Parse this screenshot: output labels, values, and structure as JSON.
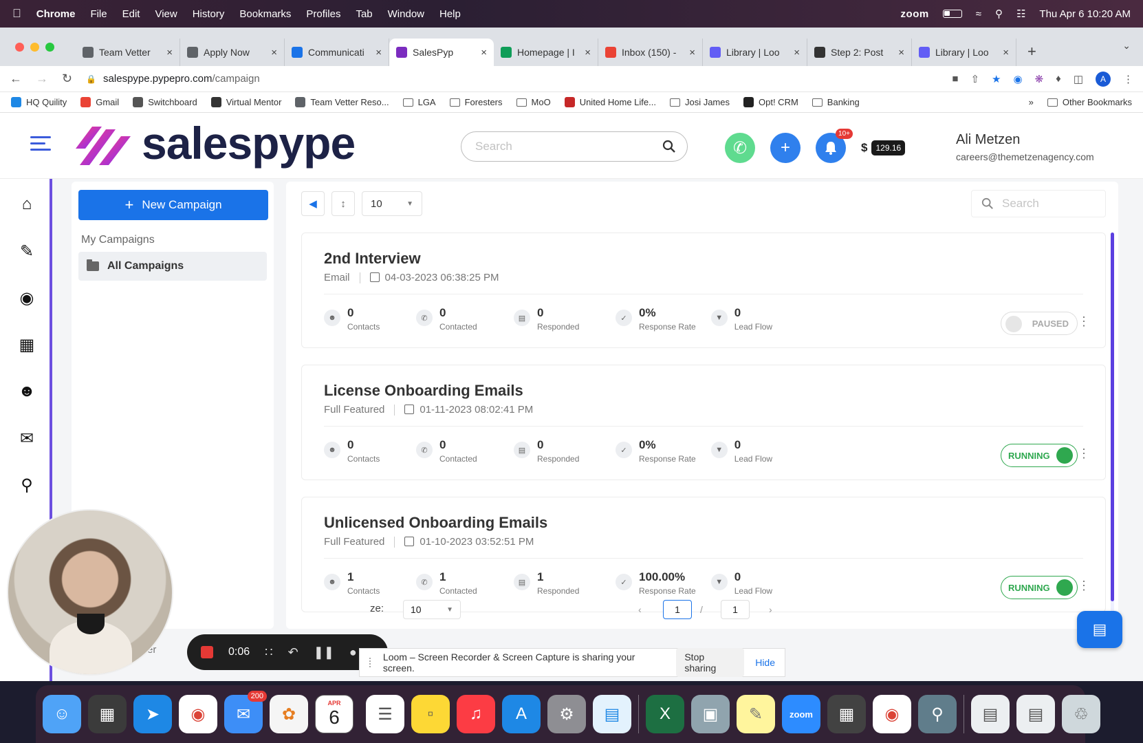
{
  "menubar": {
    "app": "Chrome",
    "items": [
      "File",
      "Edit",
      "View",
      "History",
      "Bookmarks",
      "Profiles",
      "Tab",
      "Window",
      "Help"
    ],
    "zoom_label": "zoom",
    "datetime": "Thu Apr 6  10:20 AM"
  },
  "tabs": [
    {
      "label": "Team Vetter",
      "color": "#5f6368"
    },
    {
      "label": "Apply Now",
      "color": "#5f6368"
    },
    {
      "label": "Communicati",
      "color": "#1a73e8"
    },
    {
      "label": "SalesPyp",
      "color": "#7b2cbf",
      "active": true
    },
    {
      "label": "Homepage | I",
      "color": "#0f9d58"
    },
    {
      "label": "Inbox (150) -",
      "color": "#ea4335"
    },
    {
      "label": "Library | Loo",
      "color": "#625df5"
    },
    {
      "label": "Step 2: Post",
      "color": "#333333"
    },
    {
      "label": "Library | Loo",
      "color": "#625df5"
    }
  ],
  "address": {
    "host": "salespype.pypepro.com",
    "path": "/campaign"
  },
  "bookmarks": [
    {
      "label": "HQ Quility",
      "color": "#1e88e5"
    },
    {
      "label": "Gmail",
      "color": "#ea4335"
    },
    {
      "label": "Switchboard",
      "color": "#555555"
    },
    {
      "label": "Virtual Mentor",
      "color": "#333333"
    },
    {
      "label": "Team Vetter Reso...",
      "color": "#5f6368"
    },
    {
      "label": "LGA",
      "folder": true
    },
    {
      "label": "Foresters",
      "folder": true
    },
    {
      "label": "MoO",
      "folder": true
    },
    {
      "label": "United Home Life...",
      "color": "#c62828"
    },
    {
      "label": "Josi James",
      "folder": true
    },
    {
      "label": "Opt! CRM",
      "color": "#222222"
    },
    {
      "label": "Banking",
      "folder": true
    }
  ],
  "bookmarks_overflow": "»",
  "bookmarks_other": "Other Bookmarks",
  "header": {
    "logo": "salespype",
    "search_placeholder": "Search",
    "notif_badge": "10+",
    "currency": "$",
    "balance": "129.16",
    "user_name": "Ali Metzen",
    "user_email": "careers@themetzenagency.com"
  },
  "sidebar": {
    "new_campaign": "New Campaign",
    "section_title": "My Campaigns",
    "folder": "All Campaigns"
  },
  "toolbar": {
    "per_page": "10",
    "search_placeholder": "Search"
  },
  "stat_labels": [
    "Contacts",
    "Contacted",
    "Responded",
    "Response Rate",
    "Lead Flow"
  ],
  "campaigns": [
    {
      "title": "2nd Interview",
      "type": "Email",
      "date": "04-03-2023 06:38:25 PM",
      "contacts": "0",
      "contacted": "0",
      "responded": "0",
      "rate": "0%",
      "lead_flow": "0",
      "status": "PAUSED"
    },
    {
      "title": "License Onboarding Emails",
      "type": "Full Featured",
      "date": "01-11-2023 08:02:41 PM",
      "contacts": "0",
      "contacted": "0",
      "responded": "0",
      "rate": "0%",
      "lead_flow": "0",
      "status": "RUNNING"
    },
    {
      "title": "Unlicensed Onboarding Emails",
      "type": "Full Featured",
      "date": "01-10-2023 03:52:51 PM",
      "contacts": "1",
      "contacted": "1",
      "responded": "1",
      "rate": "100.00%",
      "lead_flow": "0",
      "status": "RUNNING"
    }
  ],
  "pager": {
    "label": "ze:",
    "per_page": "10",
    "current": "1",
    "total": "1"
  },
  "loom": {
    "timer": "0:06",
    "share_message": "Loom – Screen Recorder & Screen Capture is sharing your screen.",
    "stop_label": "Stop sharing",
    "hide_label": "Hide",
    "partial_label": "er"
  },
  "dock": {
    "mail_badge": "200",
    "cal_month": "APR",
    "cal_day": "6",
    "zoom_label": "zoom"
  },
  "colors": {
    "accent": "#1a73e8",
    "running": "#2fa84f",
    "brand_purple": "#6c4fe0"
  }
}
